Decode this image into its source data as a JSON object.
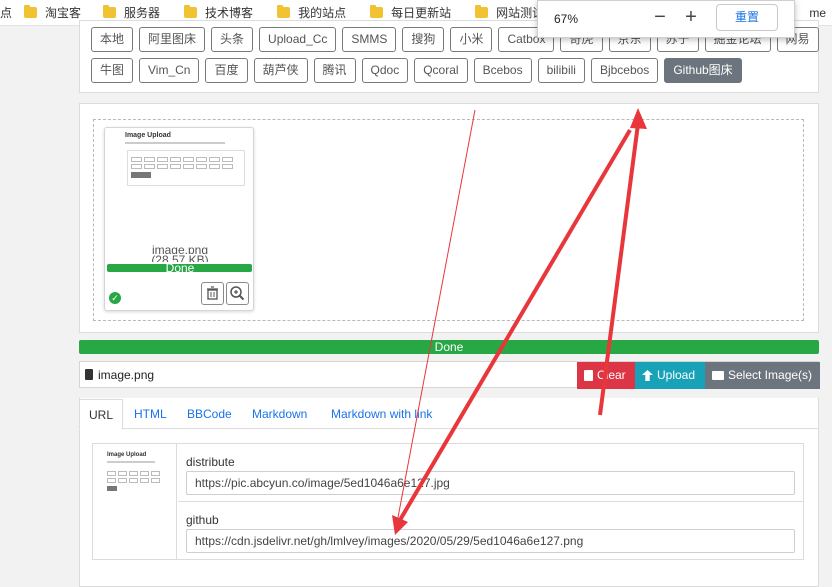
{
  "bookmarks": {
    "items": [
      {
        "label": "点",
        "folder": false
      },
      {
        "label": "淘宝客",
        "folder": true
      },
      {
        "label": "服务器",
        "folder": true
      },
      {
        "label": "技术博客",
        "folder": true
      },
      {
        "label": "我的站点",
        "folder": true
      },
      {
        "label": "每日更新站",
        "folder": true
      },
      {
        "label": "网站测试工",
        "folder": true
      }
    ],
    "overflow_label": "me"
  },
  "zoom_popup": {
    "level": "67%",
    "minus": "−",
    "plus": "+",
    "reset_label": "重置"
  },
  "hosts": {
    "row1": [
      "本地",
      "阿里图床",
      "头条",
      "Upload_Cc",
      "SMMS",
      "搜狗",
      "小米",
      "Catbox",
      "奇虎",
      "京东",
      "苏宁",
      "掘金论坛",
      "网易"
    ],
    "row2": [
      "牛图",
      "Vim_Cn",
      "百度",
      "葫芦侠",
      "腾讯",
      "Qdoc",
      "Qcoral",
      "Bcebos",
      "bilibili",
      "Bjbcebos",
      "Github图床"
    ],
    "active": "Github图床"
  },
  "preview": {
    "mini_title": "Image Upload",
    "filename": "image.png",
    "filesize": "(28.57 KB)",
    "status": "Done"
  },
  "progress": {
    "label": "Done",
    "percent": 100
  },
  "file_input": {
    "filename": "image.png",
    "clear_label": "Clear",
    "upload_label": "Upload",
    "select_label": "Select Image(s)"
  },
  "tabs": [
    "URL",
    "HTML",
    "BBCode",
    "Markdown",
    "Markdown with link"
  ],
  "results": {
    "rows": [
      {
        "label": "distribute",
        "value": "https://pic.abcyun.co/image/5ed1046a6e127.jpg"
      },
      {
        "label": "github",
        "value": "https://cdn.jsdelivr.net/gh/lmlvey/images/2020/05/29/5ed1046a6e127.png"
      }
    ],
    "mini_title": "Image Upload"
  },
  "colors": {
    "success": "#28a745",
    "danger": "#dc3545",
    "info": "#17a2b8",
    "secondary": "#6c757d",
    "link": "#1a73e8",
    "annotation": "#e8363a"
  }
}
